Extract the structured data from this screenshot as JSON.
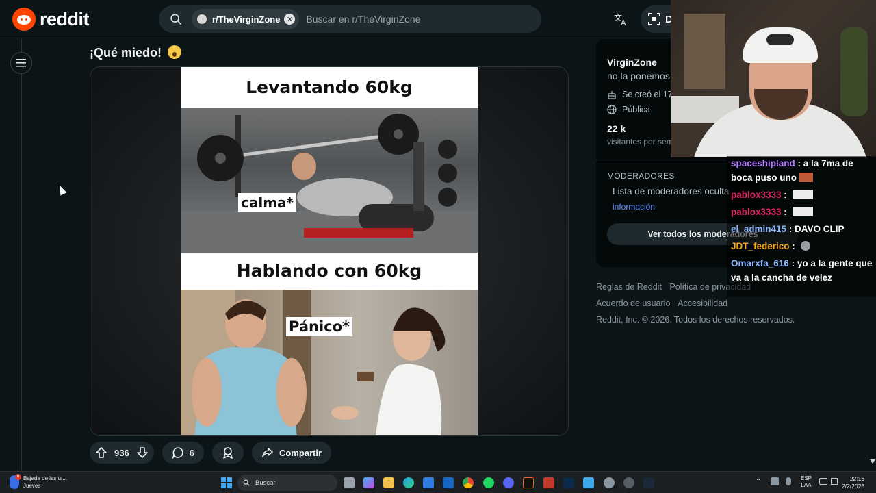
{
  "header": {
    "logo_text": "reddit",
    "search": {
      "subreddit_chip": "r/TheVirginZone",
      "placeholder": "Buscar en r/TheVirginZone"
    },
    "user_button_initial": "D"
  },
  "post": {
    "title": "¡Qué miedo!",
    "meme": {
      "caption_top": "Levantando 60kg",
      "tag_top": "calma*",
      "caption_bottom": "Hablando con 60kg",
      "tag_bottom": "Pánico*"
    },
    "actions": {
      "votes": "936",
      "comments": "6",
      "share_label": "Compartir"
    }
  },
  "sidebar": {
    "community_name": "VirginZone",
    "description": "no la ponemos",
    "created": "Se creó el 17",
    "visibility": "Pública",
    "visitors_value": "22 k",
    "visitors_label": "visitantes por sem",
    "moderators_heading": "MODERADORES",
    "moderators_text": "Lista de moderadores oculta",
    "moderators_link": "información",
    "view_all_mods": "Ver todos los moderadores"
  },
  "footer": {
    "links": [
      "Reglas de Reddit",
      "Política de privacidad",
      "Acuerdo de usuario",
      "Accesibilidad"
    ],
    "copyright": "Reddit, Inc. © 2026. Todos los derechos reservados."
  },
  "chat": [
    {
      "user": "spaceshipland",
      "color": "#b57cff",
      "message": "a la 7ma de boca puso uno"
    },
    {
      "user": "pablox3333",
      "color": "#e0245e",
      "message": ""
    },
    {
      "user": "pablox3333",
      "color": "#e0245e",
      "message": ""
    },
    {
      "user": "el_admin415",
      "color": "#8cb6ff",
      "message": "DAVO CLIP"
    },
    {
      "user": "JDT_federico",
      "color": "#f5a623",
      "message": ""
    },
    {
      "user": "Omarxfa_616",
      "color": "#8cb6ff",
      "message": "yo a la gente que va a la cancha de velez"
    }
  ],
  "taskbar": {
    "weather_title": "Bajada de las te...",
    "weather_day": "Jueves",
    "weather_badge": "6",
    "search_label": "Buscar",
    "lang_top": "ESP",
    "lang_bottom": "LAA",
    "time": "22:16",
    "date": "2/2/2026"
  },
  "colors": {
    "background": "#0b1416",
    "reddit_orange": "#ff4500",
    "link_blue": "#648efc"
  }
}
